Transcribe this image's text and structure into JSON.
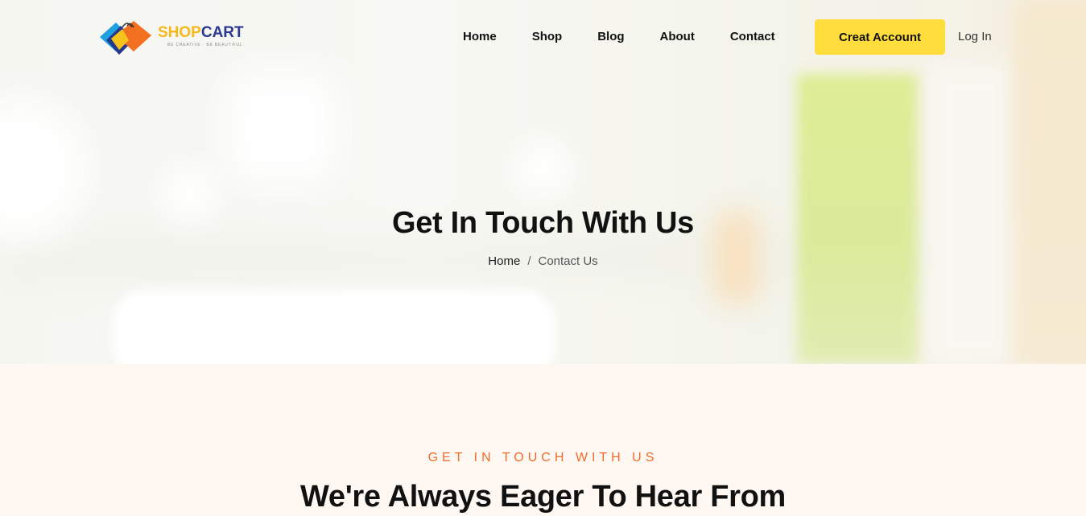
{
  "brand": {
    "name_part1": "SHOP",
    "name_part2": "CART",
    "tagline": "BE CREATIVE · BE BEAUTIFUL",
    "colors": {
      "primary_yellow": "#ffdd3c",
      "accent_orange": "#f26b2a",
      "navy": "#2b3a8f"
    }
  },
  "nav": {
    "items": [
      {
        "label": "Home"
      },
      {
        "label": "Shop"
      },
      {
        "label": "Blog"
      },
      {
        "label": "About"
      },
      {
        "label": "Contact"
      }
    ],
    "create_account_label": "Creat Account",
    "login_label": "Log In"
  },
  "hero": {
    "title": "Get In Touch With Us",
    "breadcrumb": {
      "home": "Home",
      "separator": "/",
      "current": "Contact Us"
    }
  },
  "contact_section": {
    "eyebrow": "GET IN TOUCH WITH US",
    "title": "We're Always Eager To Hear From"
  }
}
